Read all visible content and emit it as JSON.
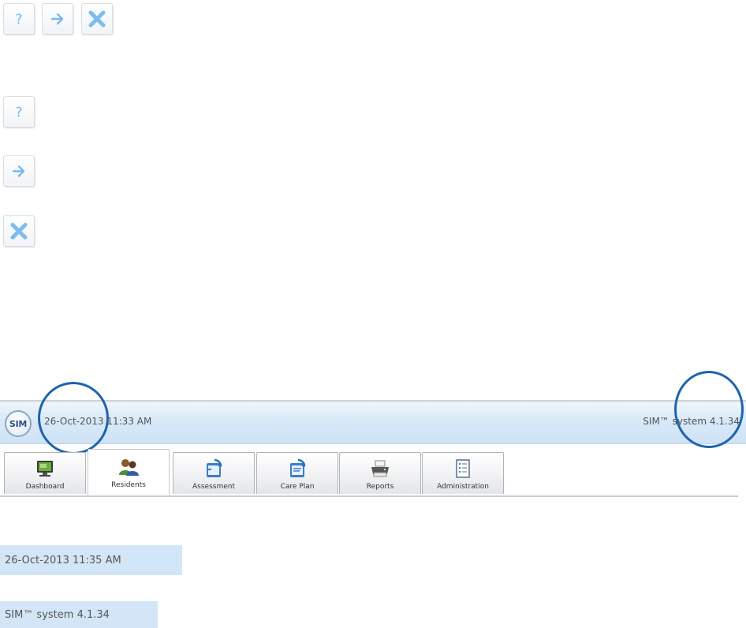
{
  "icon_buttons": {
    "help": {
      "icon": "question-mark-icon",
      "glyph": "?"
    },
    "next": {
      "icon": "arrow-right-icon"
    },
    "close": {
      "icon": "close-x-icon"
    }
  },
  "header": {
    "logo_text": "SIM",
    "datetime": "26-Oct-2013 11:33 AM",
    "version": "SIM™ system 4.1.34",
    "background_color": "#d8e9f8",
    "annotation_color": "#1f63ad"
  },
  "tabs": [
    {
      "label": "Dashboard",
      "icon": "dashboard-monitor-icon",
      "active": false
    },
    {
      "label": "Residents",
      "icon": "residents-people-icon",
      "active": true
    },
    {
      "label": "Assessment",
      "icon": "assessment-icon",
      "active": false
    },
    {
      "label": "Care Plan",
      "icon": "care-plan-icon",
      "active": false
    },
    {
      "label": "Reports",
      "icon": "reports-printer-icon",
      "active": false
    },
    {
      "label": "Administration",
      "icon": "administration-checklist-icon",
      "active": false
    }
  ],
  "snippets": {
    "datetime": "26-Oct-2013 11:35 AM",
    "version": "SIM™ system 4.1.34"
  }
}
